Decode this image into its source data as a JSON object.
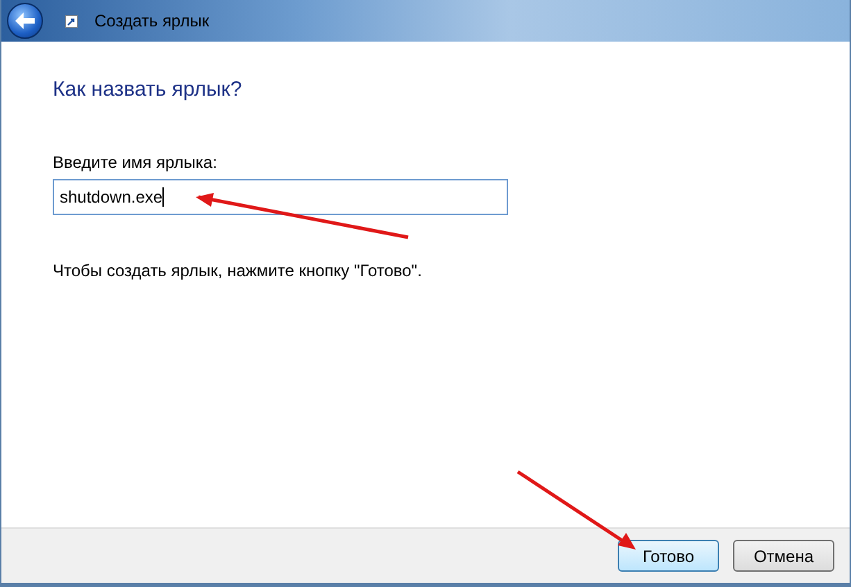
{
  "window": {
    "title": "Создать ярлык"
  },
  "heading": "Как назвать ярлык?",
  "name_field": {
    "label": "Введите имя ярлыка:",
    "value": "shutdown.exe",
    "focused": true
  },
  "hint": "Чтобы создать ярлык, нажмите кнопку \"Готово\".",
  "buttons": [
    {
      "label": "Готово",
      "default": true
    },
    {
      "label": "Отмена",
      "default": false
    }
  ]
}
